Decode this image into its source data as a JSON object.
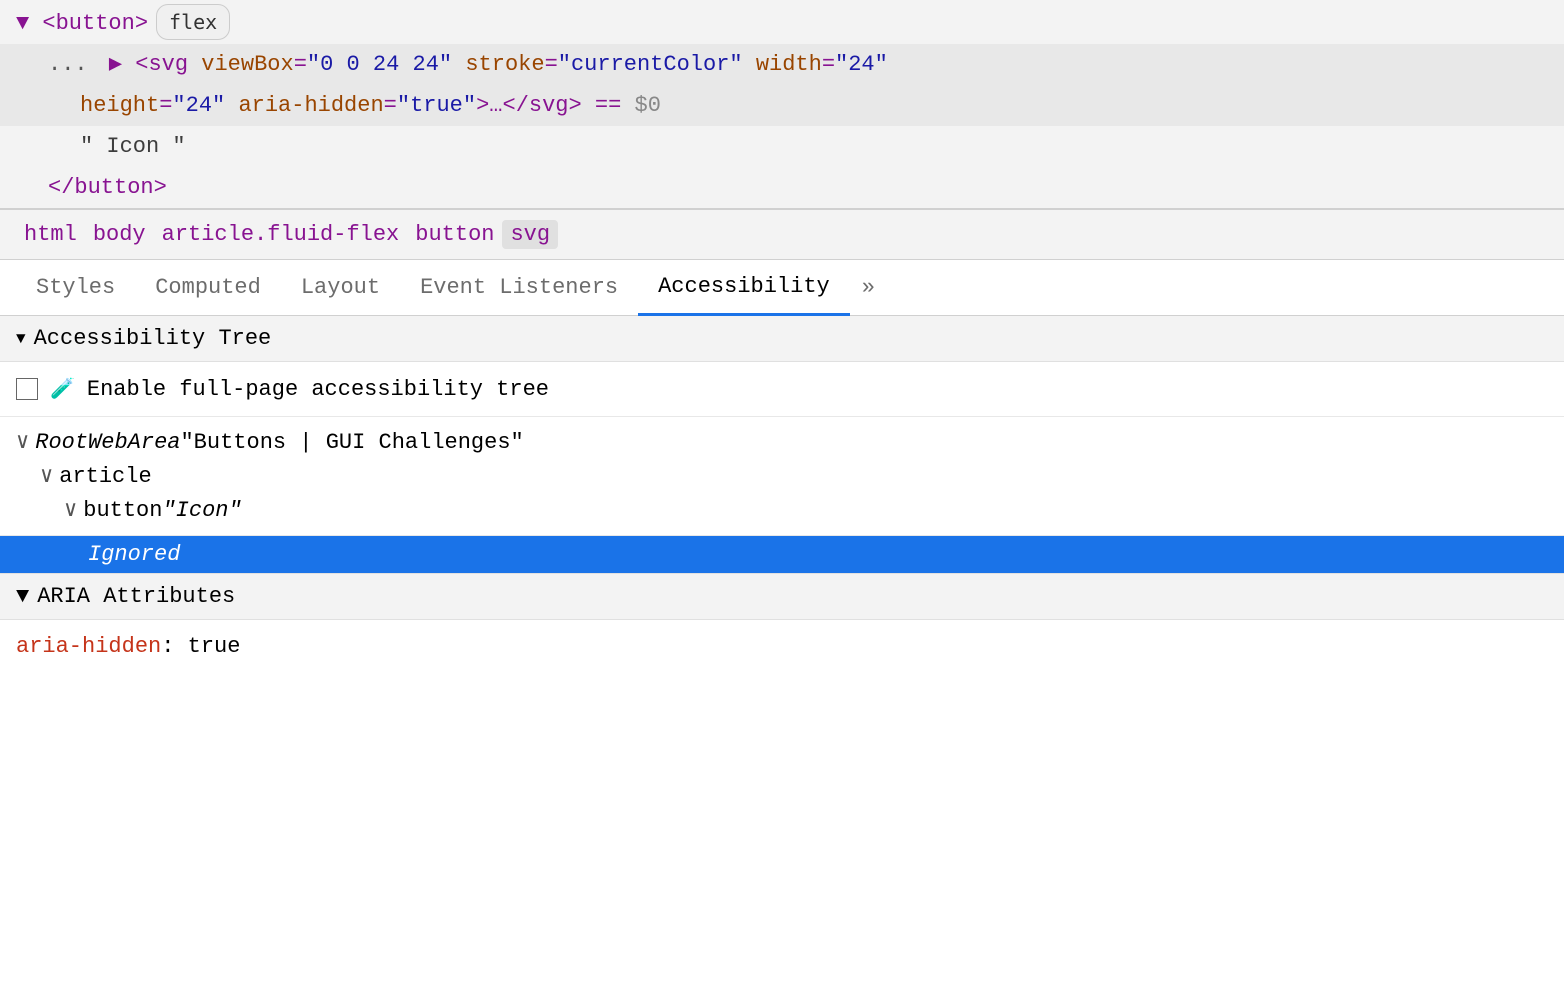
{
  "dom_inspector": {
    "lines": [
      {
        "indent": 0,
        "content_type": "button_open",
        "triangle": "▼",
        "tag": "button",
        "flex_badge": "flex"
      },
      {
        "indent": 1,
        "content_type": "svg_element",
        "dots": "...",
        "triangle": "▶",
        "highlighted": true,
        "attrs": [
          {
            "name": "viewBox",
            "value": "\"0 0 24 24\""
          },
          {
            "name": "stroke",
            "value": "\"currentColor\""
          },
          {
            "name": "width",
            "value": "\"24\""
          }
        ],
        "continuation": "height=\"24\" aria-hidden=\"true\">…</svg>",
        "dollar_zero": "== $0"
      },
      {
        "indent": 1,
        "content_type": "text_node",
        "text": "\" Icon \""
      },
      {
        "indent": 0,
        "content_type": "button_close",
        "tag": "button"
      }
    ]
  },
  "breadcrumb": {
    "items": [
      {
        "label": "html",
        "active": false
      },
      {
        "label": "body",
        "active": false
      },
      {
        "label": "article.fluid-flex",
        "active": false
      },
      {
        "label": "button",
        "active": false
      },
      {
        "label": "svg",
        "active": true
      }
    ]
  },
  "tabs": {
    "items": [
      {
        "label": "Styles",
        "active": false
      },
      {
        "label": "Computed",
        "active": false
      },
      {
        "label": "Layout",
        "active": false
      },
      {
        "label": "Event Listeners",
        "active": false
      },
      {
        "label": "Accessibility",
        "active": true
      },
      {
        "label": "»",
        "active": false,
        "is_more": true
      }
    ]
  },
  "accessibility_tree": {
    "section_label": "Accessibility Tree",
    "enable_checkbox_label": "Enable full-page accessibility tree",
    "tree_items": [
      {
        "indent": 0,
        "chevron": "∨",
        "italic": true,
        "label": "RootWebArea",
        "normal": " \"Buttons | GUI Challenges\""
      },
      {
        "indent": 1,
        "chevron": "∨",
        "italic": false,
        "label": "article"
      },
      {
        "indent": 2,
        "chevron": "∨",
        "italic": false,
        "label": "button",
        "quoted_italic": " \"Icon\""
      },
      {
        "indent": 3,
        "label": "Ignored",
        "is_ignored": true
      }
    ]
  },
  "aria_attributes": {
    "section_label": "ARIA Attributes",
    "attrs": [
      {
        "name": "aria-hidden",
        "value": "true"
      }
    ]
  }
}
